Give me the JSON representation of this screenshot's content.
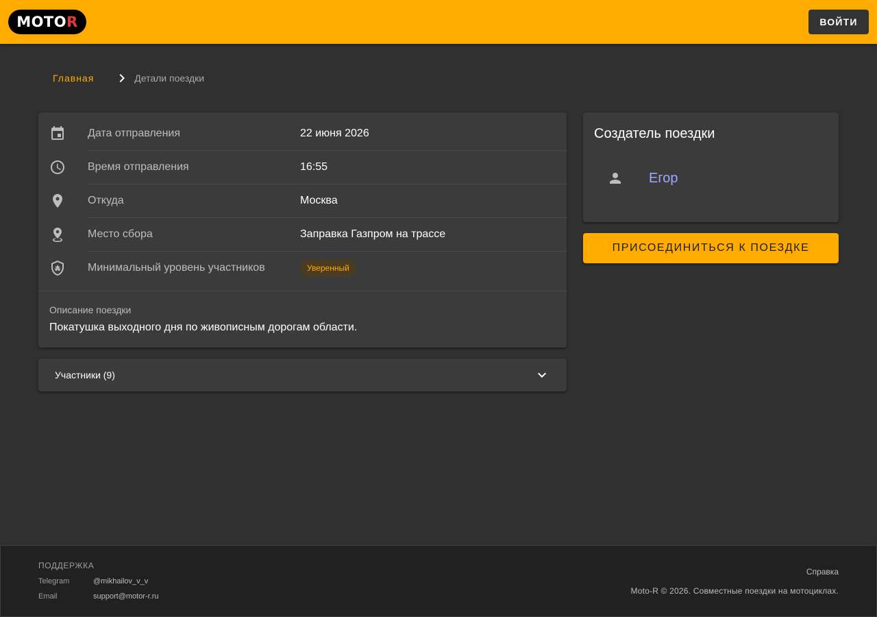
{
  "header": {
    "logo_main": "MOTO",
    "logo_accent": "R",
    "login_label": "Войти"
  },
  "breadcrumb": {
    "home": "Главная",
    "current": "Детали поездки"
  },
  "details": {
    "rows": [
      {
        "icon": "calendar-icon",
        "label": "Дата отправления",
        "value": "22 июня 2026"
      },
      {
        "icon": "clock-icon",
        "label": "Время отправления",
        "value": "16:55"
      },
      {
        "icon": "location-pin-icon",
        "label": "Откуда",
        "value": "Москва"
      },
      {
        "icon": "meeting-point-icon",
        "label": "Место сбора",
        "value": "Заправка Газпром на трассе"
      },
      {
        "icon": "shield-star-icon",
        "label": "Минимальный уровень участников",
        "value": "Уверенный"
      }
    ],
    "description_label": "Описание поездки",
    "description_text": "Покатушка выходного дня по живописным дорогам области."
  },
  "participants": {
    "label": "Участники (9)"
  },
  "creator": {
    "title": "Создатель поездки",
    "name": "Егор"
  },
  "join_label": "Присоединиться к поездке",
  "footer": {
    "support_title": "Поддержка",
    "contacts": [
      {
        "key": "Telegram",
        "value": "@mikhailov_v_v"
      },
      {
        "key": "Email",
        "value": "support@motor-r.ru"
      }
    ],
    "help": "Справка",
    "copyright": "Moto-R © 2026. Совместные поездки на мотоциклах."
  },
  "colors": {
    "accent": "#ffab00",
    "background": "#303030",
    "card": "#3b3b3b",
    "link": "#9fa8ff"
  }
}
